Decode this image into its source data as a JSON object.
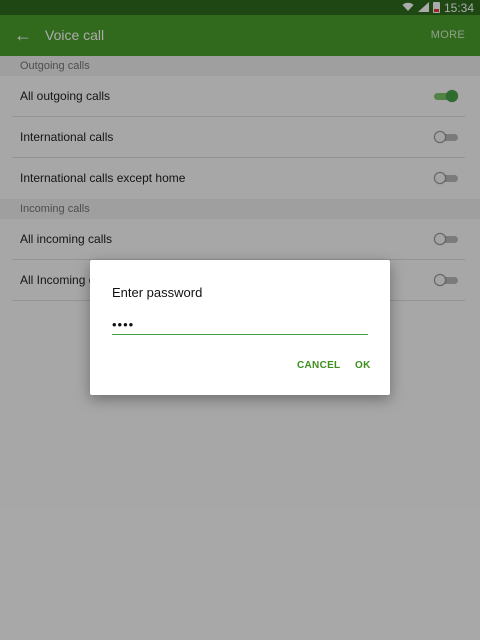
{
  "status_bar": {
    "time": "15:34"
  },
  "app_bar": {
    "back_icon": "arrow-left-icon",
    "title": "Voice call",
    "more_label": "MORE"
  },
  "sections": {
    "outgoing": {
      "header": "Outgoing calls",
      "items": [
        {
          "label": "All outgoing calls",
          "enabled": true
        },
        {
          "label": "International calls",
          "enabled": false
        },
        {
          "label": "International calls except home",
          "enabled": false
        }
      ]
    },
    "incoming": {
      "header": "Incoming calls",
      "items": [
        {
          "label": "All incoming calls",
          "enabled": false
        },
        {
          "label": "All Incoming c",
          "enabled": false
        }
      ]
    }
  },
  "dialog": {
    "title": "Enter password",
    "password_value": "••••",
    "cancel_label": "CANCEL",
    "ok_label": "OK"
  },
  "colors": {
    "status_bar": "#2e6b1f",
    "app_bar": "#4a9e2a",
    "accent": "#43a047"
  }
}
